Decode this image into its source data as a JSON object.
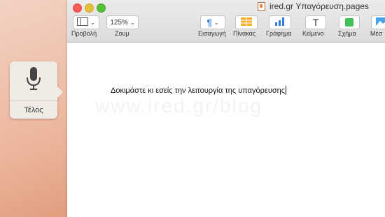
{
  "dictation": {
    "mic_icon": "microphone-icon",
    "done_label": "Τέλος"
  },
  "window": {
    "title": "ired.gr Υπαγόρευση.pages",
    "traffic_lights": {
      "close": "#fc5b57",
      "minimize": "#e5bf3c",
      "zoom": "#57c038"
    }
  },
  "toolbar": {
    "view_label": "Προβολή",
    "zoom_value": "125%",
    "zoom_label": "Ζουμ",
    "insert_label": "Εισαγωγή",
    "table_label": "Πίνακας",
    "chart_label": "Γράφημα",
    "text_label": "Κείμενο",
    "shape_label": "Σχήμα",
    "media_label": "Μέσ"
  },
  "document": {
    "body_text": "Δοκιμάστε κι εσείς την λειτουργία της υπαγόρευσης",
    "watermark": "www.ired.gr/blog"
  },
  "colors": {
    "accent_blue": "#2f7de1",
    "table_orange": "#f5b331",
    "shape_green": "#3fc25a"
  }
}
